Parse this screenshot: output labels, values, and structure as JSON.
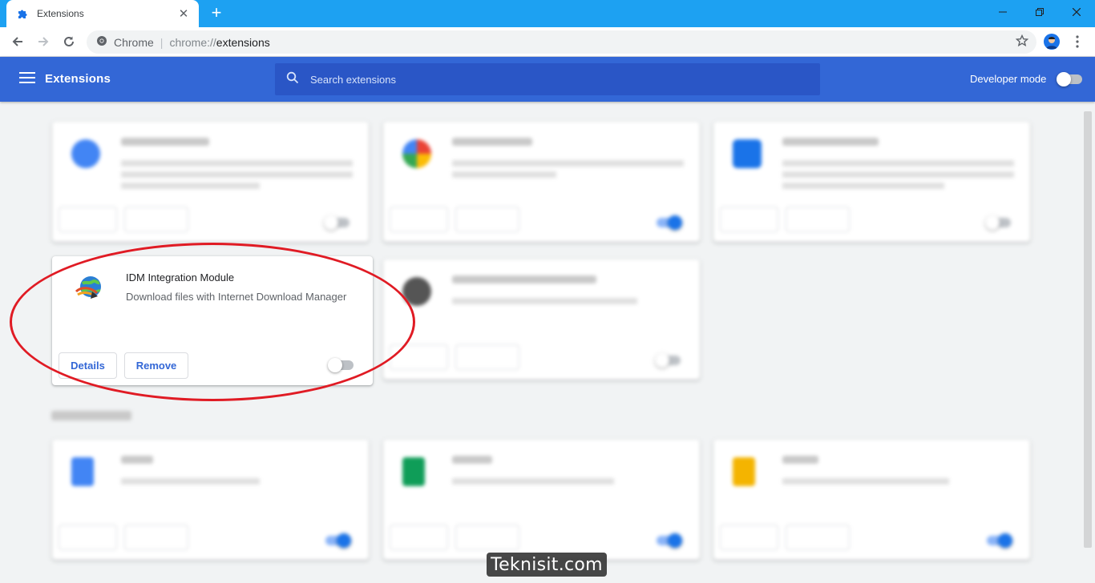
{
  "browser": {
    "tab_title": "Extensions",
    "omnibox_site": "Chrome",
    "url_scheme": "chrome://",
    "url_path": "extensions"
  },
  "header": {
    "title": "Extensions",
    "search_placeholder": "Search extensions",
    "developer_mode_label": "Developer mode",
    "developer_mode_enabled": false
  },
  "highlighted_extension": {
    "name": "IDM Integration Module",
    "description": "Download files with Internet Download Manager",
    "details_label": "Details",
    "remove_label": "Remove",
    "enabled": false
  },
  "watermark": "Teknisit.com",
  "colors": {
    "tab_strip": "#1da1f2",
    "header": "#3367d6",
    "search_field": "#2a56c6",
    "highlight_ring": "#e01b24",
    "button_text": "#3367d6"
  }
}
